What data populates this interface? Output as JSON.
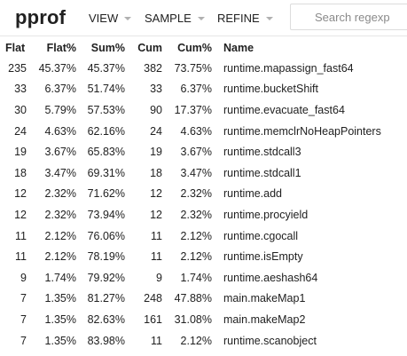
{
  "header": {
    "logo": "pprof",
    "menus": [
      {
        "label": "VIEW"
      },
      {
        "label": "SAMPLE"
      },
      {
        "label": "REFINE"
      }
    ],
    "search_placeholder": "Search regexp"
  },
  "table": {
    "columns": [
      "Flat",
      "Flat%",
      "Sum%",
      "Cum",
      "Cum%",
      "Name"
    ],
    "rows": [
      {
        "flat": "235",
        "flat_pct": "45.37%",
        "sum_pct": "45.37%",
        "cum": "382",
        "cum_pct": "73.75%",
        "name": "runtime.mapassign_fast64"
      },
      {
        "flat": "33",
        "flat_pct": "6.37%",
        "sum_pct": "51.74%",
        "cum": "33",
        "cum_pct": "6.37%",
        "name": "runtime.bucketShift"
      },
      {
        "flat": "30",
        "flat_pct": "5.79%",
        "sum_pct": "57.53%",
        "cum": "90",
        "cum_pct": "17.37%",
        "name": "runtime.evacuate_fast64"
      },
      {
        "flat": "24",
        "flat_pct": "4.63%",
        "sum_pct": "62.16%",
        "cum": "24",
        "cum_pct": "4.63%",
        "name": "runtime.memclrNoHeapPointers"
      },
      {
        "flat": "19",
        "flat_pct": "3.67%",
        "sum_pct": "65.83%",
        "cum": "19",
        "cum_pct": "3.67%",
        "name": "runtime.stdcall3"
      },
      {
        "flat": "18",
        "flat_pct": "3.47%",
        "sum_pct": "69.31%",
        "cum": "18",
        "cum_pct": "3.47%",
        "name": "runtime.stdcall1"
      },
      {
        "flat": "12",
        "flat_pct": "2.32%",
        "sum_pct": "71.62%",
        "cum": "12",
        "cum_pct": "2.32%",
        "name": "runtime.add"
      },
      {
        "flat": "12",
        "flat_pct": "2.32%",
        "sum_pct": "73.94%",
        "cum": "12",
        "cum_pct": "2.32%",
        "name": "runtime.procyield"
      },
      {
        "flat": "11",
        "flat_pct": "2.12%",
        "sum_pct": "76.06%",
        "cum": "11",
        "cum_pct": "2.12%",
        "name": "runtime.cgocall"
      },
      {
        "flat": "11",
        "flat_pct": "2.12%",
        "sum_pct": "78.19%",
        "cum": "11",
        "cum_pct": "2.12%",
        "name": "runtime.isEmpty"
      },
      {
        "flat": "9",
        "flat_pct": "1.74%",
        "sum_pct": "79.92%",
        "cum": "9",
        "cum_pct": "1.74%",
        "name": "runtime.aeshash64"
      },
      {
        "flat": "7",
        "flat_pct": "1.35%",
        "sum_pct": "81.27%",
        "cum": "248",
        "cum_pct": "47.88%",
        "name": "main.makeMap1"
      },
      {
        "flat": "7",
        "flat_pct": "1.35%",
        "sum_pct": "82.63%",
        "cum": "161",
        "cum_pct": "31.08%",
        "name": "main.makeMap2"
      },
      {
        "flat": "7",
        "flat_pct": "1.35%",
        "sum_pct": "83.98%",
        "cum": "11",
        "cum_pct": "2.12%",
        "name": "runtime.scanobject"
      }
    ]
  }
}
